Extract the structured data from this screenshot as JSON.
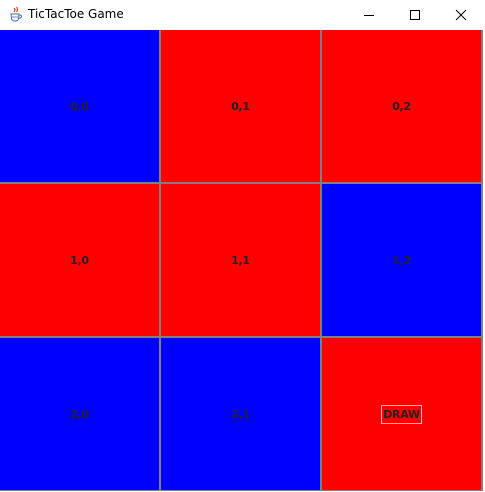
{
  "window": {
    "title": "TicTacToe Game"
  },
  "colors": {
    "blue": "#0000ff",
    "red": "#ff0000",
    "grid": "#808080",
    "label": "#222222"
  },
  "board": {
    "cells": [
      {
        "label": "0,0",
        "color": "blue"
      },
      {
        "label": "0,1",
        "color": "red"
      },
      {
        "label": "0,2",
        "color": "red"
      },
      {
        "label": "1,0",
        "color": "red"
      },
      {
        "label": "1,1",
        "color": "red"
      },
      {
        "label": "1,2",
        "color": "blue"
      },
      {
        "label": "2,0",
        "color": "blue"
      },
      {
        "label": "2,1",
        "color": "blue"
      },
      {
        "label": "DRAW",
        "color": "red"
      }
    ]
  }
}
